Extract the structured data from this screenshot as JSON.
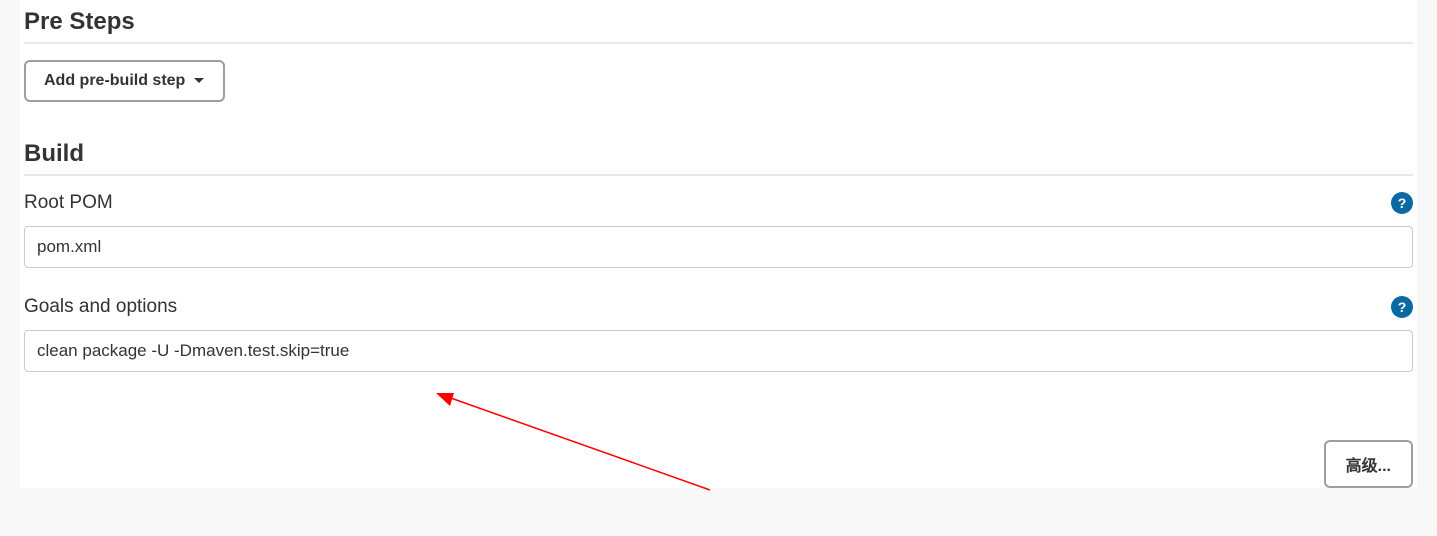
{
  "preSteps": {
    "heading": "Pre Steps",
    "addButtonLabel": "Add pre-build step"
  },
  "build": {
    "heading": "Build",
    "rootPom": {
      "label": "Root POM",
      "value": "pom.xml"
    },
    "goals": {
      "label": "Goals and options",
      "value": "clean package -U -Dmaven.test.skip=true"
    },
    "advancedButtonLabel": "高级..."
  },
  "helpIcon": "?"
}
